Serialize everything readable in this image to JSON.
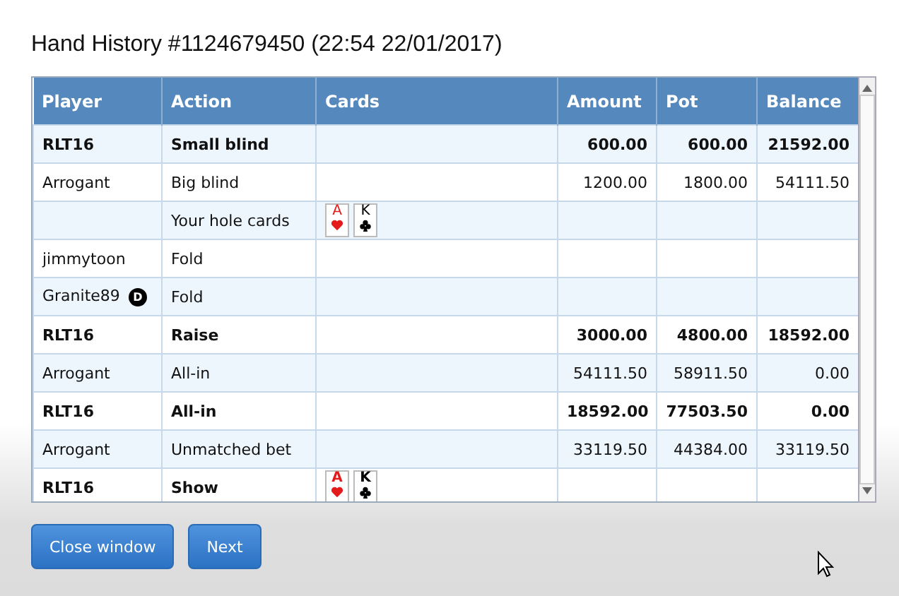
{
  "window": {
    "title": "Hand History #1124679450 (22:54 22/01/2017)"
  },
  "table": {
    "columns": [
      "Player",
      "Action",
      "Cards",
      "Amount",
      "Pot",
      "Balance"
    ],
    "rows": [
      {
        "player": "RLT16",
        "action": "Small blind",
        "cards": [],
        "amount": "600.00",
        "pot": "600.00",
        "balance": "21592.00",
        "own": true
      },
      {
        "player": "Arrogant",
        "action": "Big blind",
        "cards": [],
        "amount": "1200.00",
        "pot": "1800.00",
        "balance": "54111.50",
        "own": false
      },
      {
        "player": "",
        "action": "Your hole cards",
        "cards": [
          {
            "rank": "A",
            "kind": "hearts"
          },
          {
            "rank": "K",
            "kind": "clubs"
          }
        ],
        "amount": "",
        "pot": "",
        "balance": "",
        "own": false
      },
      {
        "player": "jimmytoon",
        "action": "Fold",
        "cards": [],
        "amount": "",
        "pot": "",
        "balance": "",
        "own": false
      },
      {
        "player": "Granite89",
        "dealer_button": "D",
        "action": "Fold",
        "cards": [],
        "amount": "",
        "pot": "",
        "balance": "",
        "own": false
      },
      {
        "player": "RLT16",
        "action": "Raise",
        "cards": [],
        "amount": "3000.00",
        "pot": "4800.00",
        "balance": "18592.00",
        "own": true
      },
      {
        "player": "Arrogant",
        "action": "All-in",
        "cards": [],
        "amount": "54111.50",
        "pot": "58911.50",
        "balance": "0.00",
        "own": false
      },
      {
        "player": "RLT16",
        "action": "All-in",
        "cards": [],
        "amount": "18592.00",
        "pot": "77503.50",
        "balance": "0.00",
        "own": true
      },
      {
        "player": "Arrogant",
        "action": "Unmatched bet",
        "cards": [],
        "amount": "33119.50",
        "pot": "44384.00",
        "balance": "33119.50",
        "own": false
      },
      {
        "player": "RLT16",
        "action": "Show",
        "cards": [
          {
            "rank": "A",
            "kind": "hearts"
          },
          {
            "rank": "K",
            "kind": "clubs"
          }
        ],
        "amount": "",
        "pot": "",
        "balance": "",
        "own": true
      }
    ]
  },
  "buttons": [
    "Close window",
    "Next"
  ]
}
